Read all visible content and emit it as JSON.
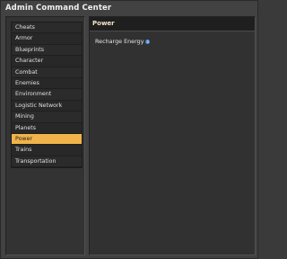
{
  "window": {
    "title": "Admin Command Center"
  },
  "categories": [
    {
      "label": "Cheats",
      "selected": false
    },
    {
      "label": "Armor",
      "selected": false
    },
    {
      "label": "Blueprints",
      "selected": false
    },
    {
      "label": "Character",
      "selected": false
    },
    {
      "label": "Combat",
      "selected": false
    },
    {
      "label": "Enemies",
      "selected": false
    },
    {
      "label": "Environment",
      "selected": false
    },
    {
      "label": "Logistic Network",
      "selected": false
    },
    {
      "label": "Mining",
      "selected": false
    },
    {
      "label": "Planets",
      "selected": false
    },
    {
      "label": "Power",
      "selected": true
    },
    {
      "label": "Trains",
      "selected": false
    },
    {
      "label": "Transportation",
      "selected": false
    }
  ],
  "panel": {
    "header": "Power",
    "settings": [
      {
        "label": "Recharge Energy",
        "icon": "info-icon"
      }
    ]
  },
  "colors": {
    "selected_bg": "#f0b44a",
    "header_text": "#f4e6c8",
    "info_icon": "#4f8fd8"
  }
}
